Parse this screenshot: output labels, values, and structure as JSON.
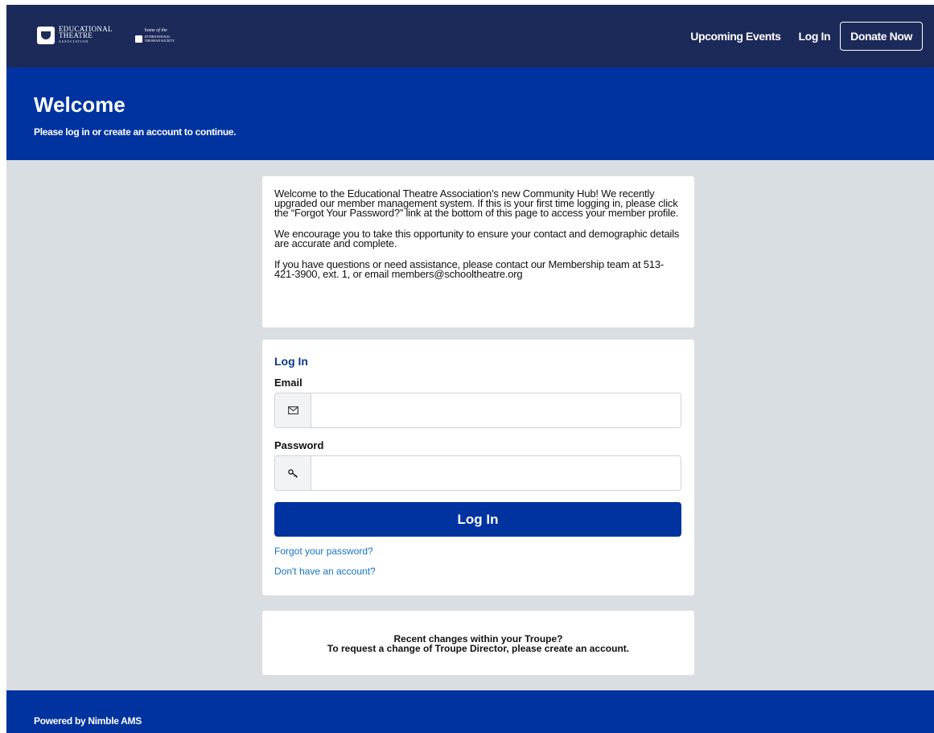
{
  "header": {
    "logo_alt": "Educational Theatre Association",
    "logo_line1": "EDUCATIONAL",
    "logo_line2": "THEATRE",
    "logo_line3": "ASSOCIATION",
    "home_of": "home of the",
    "ints_line1": "INTERNATIONAL",
    "ints_line2": "THESPIAN SOCIETY",
    "nav": {
      "upcoming_events": "Upcoming Events",
      "login": "Log In",
      "donate": "Donate Now"
    }
  },
  "hero": {
    "title": "Welcome",
    "subtitle": "Please log in or create an account to continue."
  },
  "intro": {
    "p1": "Welcome to the Educational Theatre Association’s new Community Hub! We recently upgraded our member management system. If this is your first time logging in, please click the “Forgot Your Password?” link at the bottom of this page to access your member profile.",
    "p2": "We encourage you to take this opportunity to ensure your contact and demographic details are accurate and complete.",
    "p3": "If you have questions or need assistance, please contact our Membership team at 513-421-3900, ext. 1, or email members@schooltheatre.org"
  },
  "login": {
    "title": "Log In",
    "email_label": "Email",
    "email_value": "",
    "password_label": "Password",
    "password_value": "",
    "submit": "Log In",
    "forgot": "Forgot your password?",
    "no_account": "Don't have an account?"
  },
  "troupe": {
    "line1": "Recent changes within your Troupe?",
    "line2": "To request a change of Troupe Director, please create an account."
  },
  "footer": {
    "powered_by": "Powered by Nimble AMS"
  },
  "icons": {
    "email": "envelope-icon",
    "password": "key-icon"
  },
  "colors": {
    "nav_bg": "#1c2a5a",
    "brand_blue": "#0033a0",
    "page_bg": "#d9dee2",
    "link": "#1673c5"
  }
}
